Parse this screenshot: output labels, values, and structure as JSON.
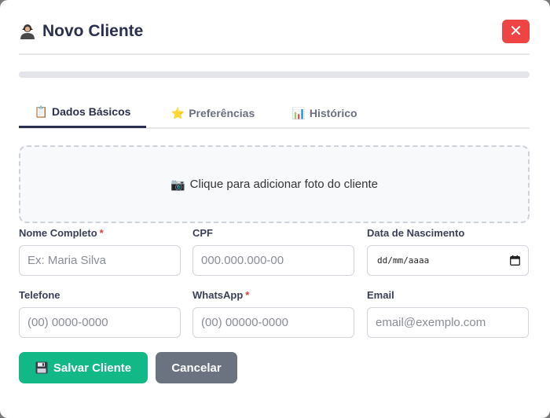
{
  "modal": {
    "title": "Novo Cliente",
    "title_icon": "person-icon",
    "close_label": "✕"
  },
  "progress": {
    "value_percent": 0
  },
  "tabs": [
    {
      "label": "Dados Básicos",
      "icon": "clipboard-icon",
      "active": true
    },
    {
      "label": "Preferências",
      "icon": "star-icon",
      "active": false
    },
    {
      "label": "Histórico",
      "icon": "bar-chart-icon",
      "active": false
    }
  ],
  "photo": {
    "label": "Clique para adicionar foto do cliente",
    "icon": "camera-icon"
  },
  "fields": {
    "nome": {
      "label": "Nome Completo",
      "required": "*",
      "placeholder": "Ex: Maria Silva"
    },
    "cpf": {
      "label": "CPF",
      "placeholder": "000.000.000-00"
    },
    "nascimento": {
      "label": "Data de Nascimento",
      "placeholder": "dd/mm/aaaa"
    },
    "telefone": {
      "label": "Telefone",
      "placeholder": "(00) 0000-0000"
    },
    "whatsapp": {
      "label": "WhatsApp",
      "required": "*",
      "placeholder": "(00) 00000-0000"
    },
    "email": {
      "label": "Email",
      "placeholder": "email@exemplo.com"
    }
  },
  "buttons": {
    "save": "Salvar Cliente",
    "cancel": "Cancelar"
  },
  "colors": {
    "primary": "#2b3050",
    "success": "#12b886",
    "danger": "#ef4444",
    "secondary": "#6b7280"
  }
}
